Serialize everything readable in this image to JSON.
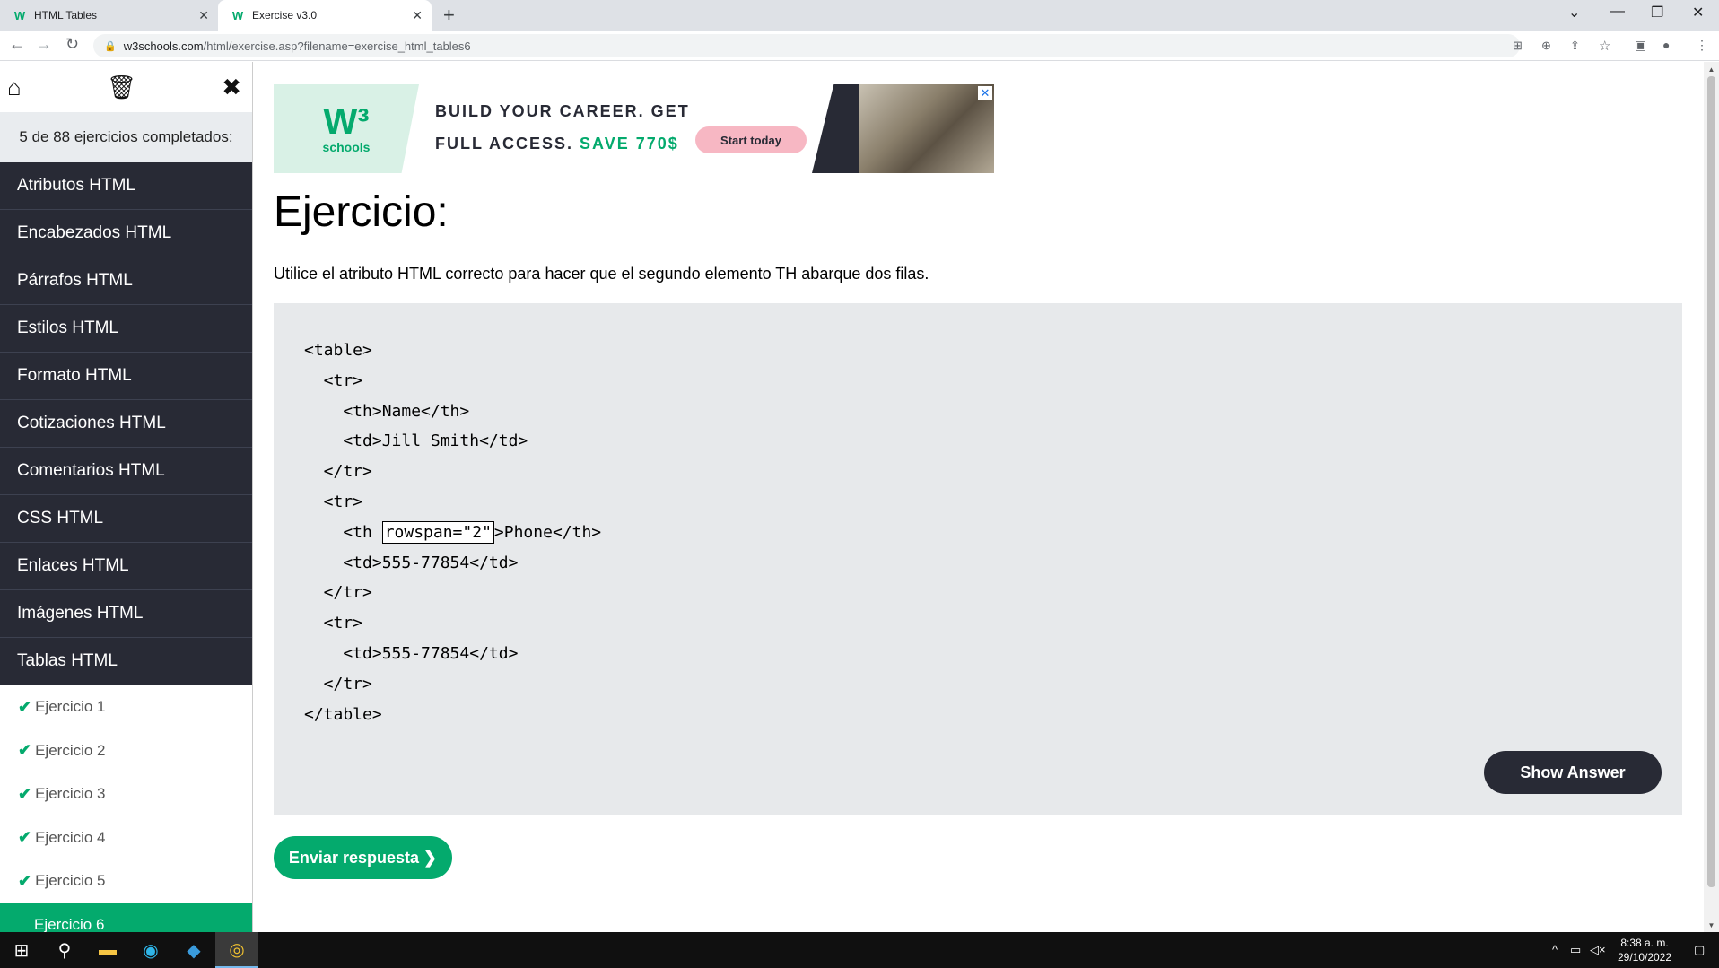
{
  "browser": {
    "tabs": [
      {
        "title": "HTML Tables",
        "active": false
      },
      {
        "title": "Exercise v3.0",
        "active": true
      }
    ],
    "url_host": "w3schools.com",
    "url_path": "/html/exercise.asp?filename=exercise_html_tables6"
  },
  "sidebar": {
    "progress": "5 de 88 ejercicios completados:",
    "sections": [
      "Atributos HTML",
      "Encabezados HTML",
      "Párrafos HTML",
      "Estilos HTML",
      "Formato HTML",
      "Cotizaciones HTML",
      "Comentarios HTML",
      "CSS HTML",
      "Enlaces HTML",
      "Imágenes HTML",
      "Tablas HTML"
    ],
    "exercises": [
      "Ejercicio 1",
      "Ejercicio 2",
      "Ejercicio 3",
      "Ejercicio 4",
      "Ejercicio 5",
      "Ejercicio 6"
    ],
    "active_exercise": "Ejercicio 6"
  },
  "ad": {
    "logo_text": "schools",
    "line1": "BUILD YOUR CAREER. GET",
    "line2a": "FULL ACCESS.",
    "line2b": "SAVE 770$",
    "cta": "Start today"
  },
  "exercise": {
    "heading": "Ejercicio:",
    "instruction": "Utilice el atributo HTML correcto para hacer que el segundo elemento TH abarque dos filas.",
    "code": {
      "l1": "<table>",
      "l2": "  <tr>",
      "l3": "    <th>Name</th>",
      "l4": "    <td>Jill Smith</td>",
      "l5": "  </tr>",
      "l6": "  <tr>",
      "l7_pre": "    <th ",
      "l7_input": "rowspan=\"2\"",
      "l7_post": ">Phone</th>",
      "l8": "    <td>555-77854</td>",
      "l9": "  </tr>",
      "l10": "  <tr>",
      "l11": "    <td>555-77854</td>",
      "l12": "  </tr>",
      "l13": "</table>"
    },
    "show_answer": "Show Answer",
    "submit": "Enviar respuesta ❯"
  },
  "taskbar": {
    "time": "8:38 a. m.",
    "date": "29/10/2022"
  },
  "colors": {
    "accent": "#04aa6d",
    "dark": "#282a35",
    "code_bg": "#e7e9eb"
  }
}
